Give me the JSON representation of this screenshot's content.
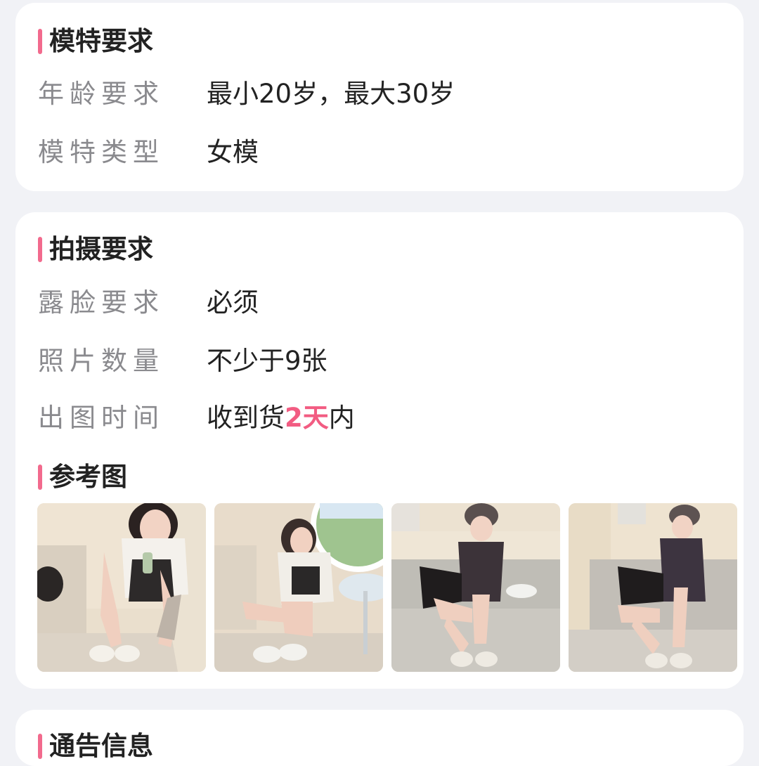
{
  "model_section": {
    "title": "模特要求",
    "age_label": "年龄要求",
    "age_value": "最小20岁，最大30岁",
    "type_label": "模特类型",
    "type_value": "女模"
  },
  "shoot_section": {
    "title": "拍摄要求",
    "face_label": "露脸要求",
    "face_value": "必须",
    "count_label": "照片数量",
    "count_value": "不少于9张",
    "time_label": "出图时间",
    "time_prefix": "收到货",
    "time_highlight": "2天",
    "time_suffix": "内",
    "reference_title": "参考图",
    "reference_images": [
      "reference-photo-1",
      "reference-photo-2",
      "reference-photo-3",
      "reference-photo-4"
    ]
  },
  "next_section": {
    "title": "通告信息"
  },
  "colors": {
    "accent": "#f26a8d",
    "highlight": "#f25c82",
    "label_gray": "#8a8a8e",
    "background": "#f1f2f6"
  }
}
